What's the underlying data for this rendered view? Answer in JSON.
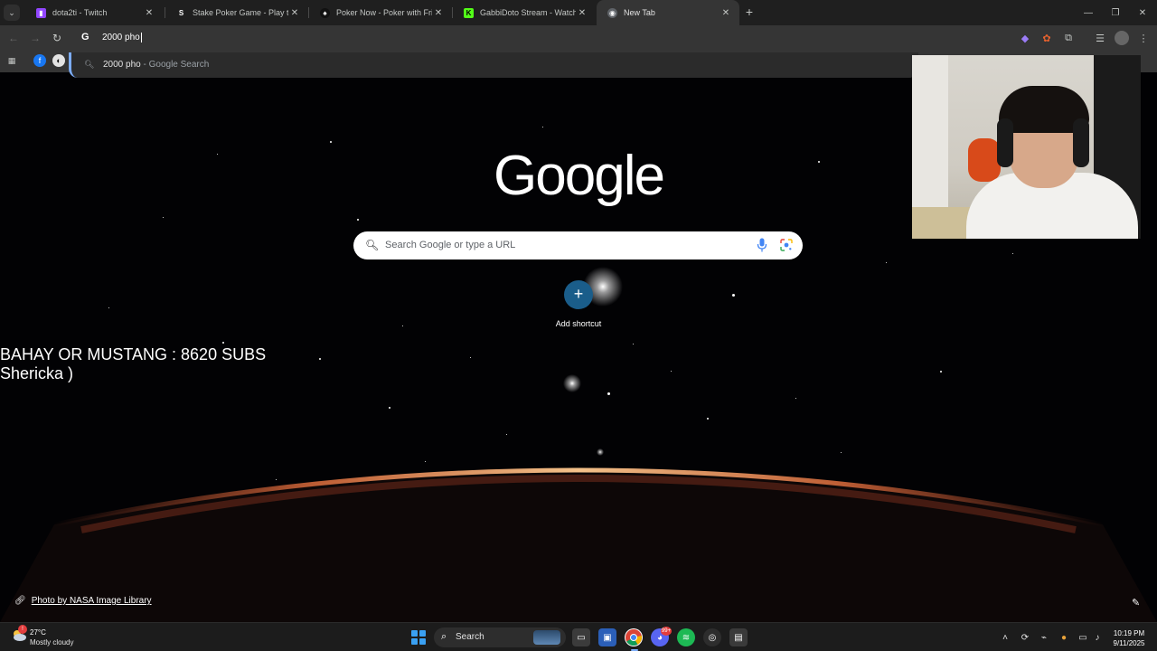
{
  "browser": {
    "tabs": [
      {
        "title": "dota2ti - Twitch",
        "icon": "twitch-icon",
        "active": false
      },
      {
        "title": "Stake Poker Game - Play the Be",
        "icon": "stake-icon",
        "active": false
      },
      {
        "title": "Poker Now - Poker with Friends",
        "icon": "pokernow-icon",
        "active": false
      },
      {
        "title": "GabbiDoto Stream - Watch Live",
        "icon": "kick-icon",
        "active": false
      },
      {
        "title": "New Tab",
        "icon": "chrome-icon",
        "active": true
      }
    ],
    "new_tab_symbol": "+",
    "close_symbol": "✕",
    "omnibox": {
      "value": "2000 pho"
    },
    "suggestion": {
      "query": "2000 pho",
      "suffix": " - Google Search"
    }
  },
  "ntp": {
    "logo": "Google",
    "search_placeholder": "Search Google or type a URL",
    "add_shortcut_label": "Add shortcut",
    "photo_credit": "Photo by NASA Image Library"
  },
  "stream_overlay": {
    "line1": "BAHAY OR MUSTANG : 8620 SUBS",
    "line2": "Shericka )"
  },
  "taskbar": {
    "weather_temp": "27°C",
    "weather_desc": "Mostly cloudy",
    "search_label": "Search",
    "time": "10:19 PM",
    "date": "9/11/2025",
    "notification_badge": "99+"
  },
  "colors": {
    "accent_blue": "#7cacf8",
    "add_button": "#1a5d8a",
    "twitch": "#9146ff",
    "kick": "#53fc18"
  }
}
